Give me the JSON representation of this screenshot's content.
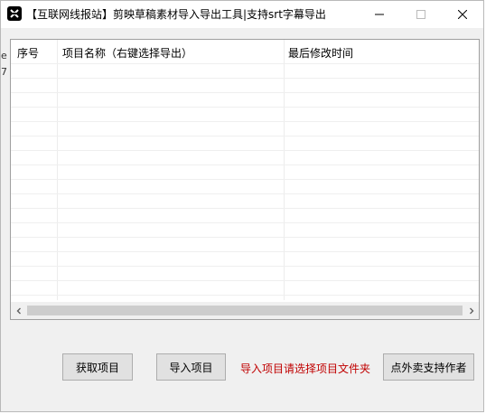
{
  "window": {
    "title": "【互联网线报站】剪映草稿素材导入导出工具|支持srt字幕导出",
    "icon": "capcut-logo-icon"
  },
  "side_glyphs": [
    "e",
    "7"
  ],
  "listview": {
    "columns": [
      "序号",
      "项目名称（右键选择导出）",
      "最后修改时间"
    ],
    "rows": []
  },
  "buttons": {
    "fetch_label": "获取项目",
    "import_label": "导入项目",
    "support_label": "点外卖支持作者"
  },
  "hint": {
    "text": "导入项目请选择项目文件夹",
    "color": "#c00000"
  }
}
